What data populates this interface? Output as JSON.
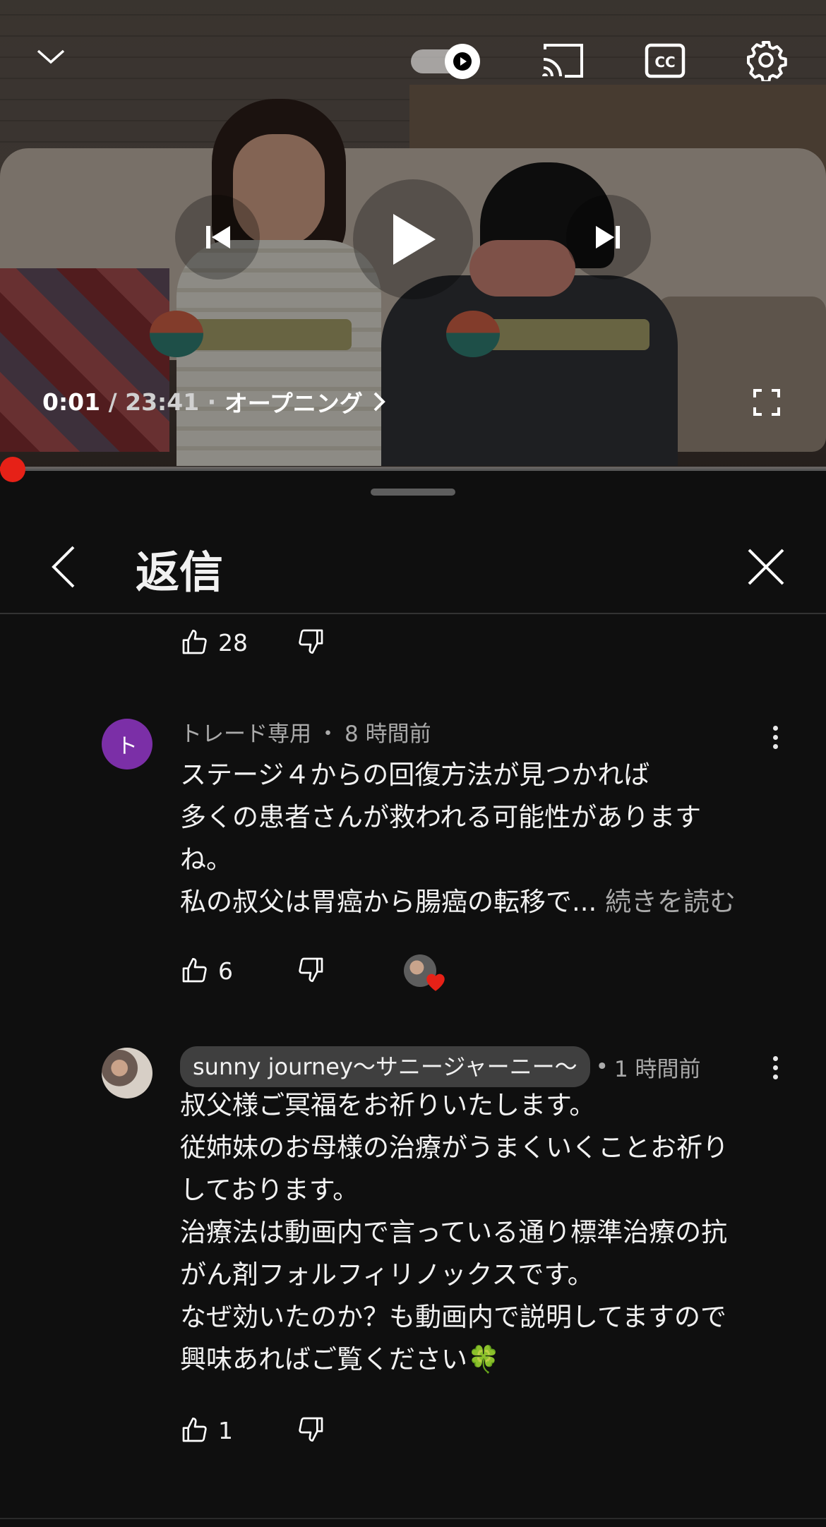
{
  "player": {
    "time_current": "0:01",
    "time_separator": " / ",
    "time_total": "23:41",
    "chapter_separator": " · ",
    "chapter": "オープニング",
    "progress": 0.0007,
    "icons": [
      "chevron-down-icon",
      "autoplay-toggle",
      "cast-icon",
      "cc-icon",
      "settings-icon",
      "previous-icon",
      "play-icon",
      "next-icon",
      "fullscreen-icon"
    ]
  },
  "panel": {
    "title": "返信"
  },
  "top_actions": {
    "like_count": "28"
  },
  "comments": [
    {
      "avatar_letter": "ト",
      "author": "トレード専用",
      "separator": "・",
      "time": "8 時間前",
      "lines": [
        "ステージ４からの回復方法が見つかれば",
        "多くの患者さんが救われる可能性があります",
        "ね。",
        "私の叔父は胃癌から腸癌の転移で..."
      ],
      "read_more": "続きを読む",
      "like_count": "6",
      "creator_heart": true
    },
    {
      "author": "sunny journey〜サニージャーニー〜",
      "separator": "•",
      "time": "1 時間前",
      "lines": [
        "叔父様ご冥福をお祈りいたします。",
        "従姉妹のお母様の治療がうまくいくことお祈り",
        "しております。",
        "治療法は動画内で言っている通り標準治療の抗",
        "がん剤フォルフィリノックスです。",
        "なぜ効いたのか？も動画内で説明してますので",
        "興味あればご覧ください🍀"
      ],
      "like_count": "1"
    }
  ],
  "colors": {
    "background": "#0f0f0f",
    "progress": "#ff0000",
    "avatar_purple": "#7b2fa7",
    "muted_text": "#aaaaaa",
    "heart": "#e62117"
  }
}
